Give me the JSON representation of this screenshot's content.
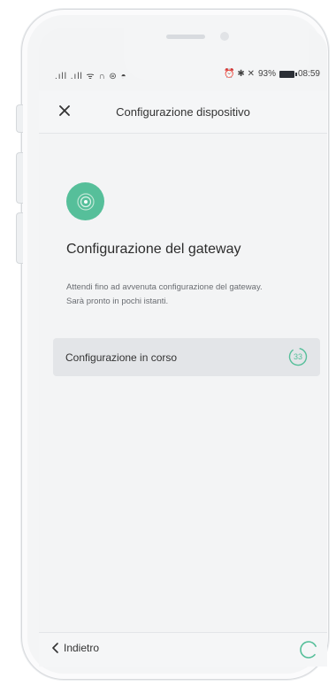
{
  "status_bar": {
    "left_icons": ".ıll .ıll ᯤ ∩ ⊜ ◓",
    "right_icons": "⏰ ✱ ✕",
    "battery_percent": "93%",
    "time": "08:59"
  },
  "app_bar": {
    "close_icon": "close-icon",
    "title": "Configurazione dispositivo"
  },
  "content": {
    "hero_icon": "signal-icon",
    "heading": "Configurazione del gateway",
    "description_line1": "Attendi fino ad avvenuta configurazione del gateway.",
    "description_line2": "Sarà pronto in pochi istanti.",
    "progress_label": "Configurazione in corso",
    "progress_count": "33"
  },
  "bottom_bar": {
    "back_label": "Indietro"
  },
  "colors": {
    "accent": "#56bf9a",
    "background": "#f3f4f5",
    "row_background": "#e3e5e8"
  }
}
